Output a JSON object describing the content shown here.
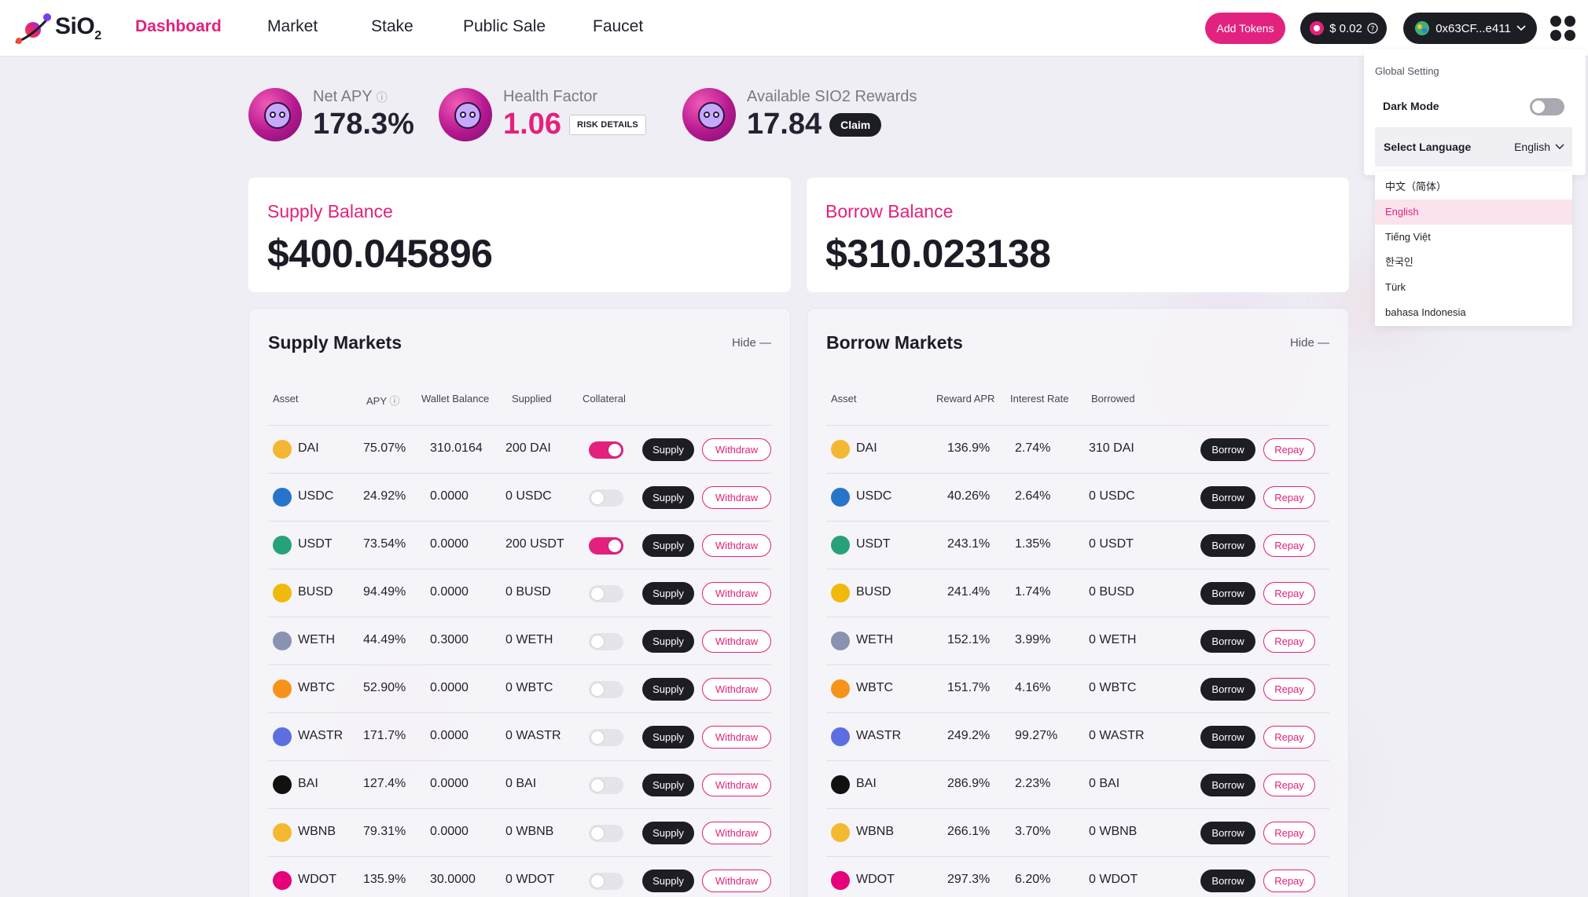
{
  "header": {
    "logo_text": "SiO",
    "logo_sub": "2",
    "nav": [
      {
        "label": "Dashboard",
        "active": true
      },
      {
        "label": "Market",
        "active": false
      },
      {
        "label": "Stake",
        "active": false
      },
      {
        "label": "Public Sale",
        "active": false
      },
      {
        "label": "Faucet",
        "active": false
      }
    ],
    "add_tokens": "Add Tokens",
    "price": "$ 0.02",
    "address": "0x63CF...e411"
  },
  "stats": {
    "net_apy_label": "Net APY",
    "net_apy_value": "178.3%",
    "health_label": "Health Factor",
    "health_value": "1.06",
    "risk_details": "RISK DETAILS",
    "rewards_label": "Available SIO2 Rewards",
    "rewards_value": "17.84",
    "claim": "Claim"
  },
  "supply_balance": {
    "label": "Supply Balance",
    "value": "$400.045896"
  },
  "borrow_balance": {
    "label": "Borrow Balance",
    "value": "$310.023138"
  },
  "supply_markets": {
    "title": "Supply Markets",
    "hide": "Hide",
    "headers": [
      "Asset",
      "APY",
      "Wallet Balance",
      "Supplied",
      "Collateral"
    ],
    "supply_label": "Supply",
    "withdraw_label": "Withdraw",
    "rows": [
      {
        "asset": "DAI",
        "apy": "75.07%",
        "wallet": "310.0164",
        "supplied": "200 DAI",
        "collateral": true
      },
      {
        "asset": "USDC",
        "apy": "24.92%",
        "wallet": "0.0000",
        "supplied": "0 USDC",
        "collateral": false
      },
      {
        "asset": "USDT",
        "apy": "73.54%",
        "wallet": "0.0000",
        "supplied": "200 USDT",
        "collateral": true
      },
      {
        "asset": "BUSD",
        "apy": "94.49%",
        "wallet": "0.0000",
        "supplied": "0 BUSD",
        "collateral": false
      },
      {
        "asset": "WETH",
        "apy": "44.49%",
        "wallet": "0.3000",
        "supplied": "0 WETH",
        "collateral": false
      },
      {
        "asset": "WBTC",
        "apy": "52.90%",
        "wallet": "0.0000",
        "supplied": "0 WBTC",
        "collateral": false
      },
      {
        "asset": "WASTR",
        "apy": "171.7%",
        "wallet": "0.0000",
        "supplied": "0 WASTR",
        "collateral": false
      },
      {
        "asset": "BAI",
        "apy": "127.4%",
        "wallet": "0.0000",
        "supplied": "0 BAI",
        "collateral": false
      },
      {
        "asset": "WBNB",
        "apy": "79.31%",
        "wallet": "0.0000",
        "supplied": "0 WBNB",
        "collateral": false
      },
      {
        "asset": "WDOT",
        "apy": "135.9%",
        "wallet": "30.0000",
        "supplied": "0 WDOT",
        "collateral": false
      }
    ]
  },
  "borrow_markets": {
    "title": "Borrow Markets",
    "hide": "Hide",
    "headers": [
      "Asset",
      "Reward APR",
      "Interest Rate",
      "Borrowed"
    ],
    "borrow_label": "Borrow",
    "repay_label": "Repay",
    "rows": [
      {
        "asset": "DAI",
        "reward": "136.9%",
        "interest": "2.74%",
        "borrowed": "310 DAI"
      },
      {
        "asset": "USDC",
        "reward": "40.26%",
        "interest": "2.64%",
        "borrowed": "0 USDC"
      },
      {
        "asset": "USDT",
        "reward": "243.1%",
        "interest": "1.35%",
        "borrowed": "0 USDT"
      },
      {
        "asset": "BUSD",
        "reward": "241.4%",
        "interest": "1.74%",
        "borrowed": "0 BUSD"
      },
      {
        "asset": "WETH",
        "reward": "152.1%",
        "interest": "3.99%",
        "borrowed": "0 WETH"
      },
      {
        "asset": "WBTC",
        "reward": "151.7%",
        "interest": "4.16%",
        "borrowed": "0 WBTC"
      },
      {
        "asset": "WASTR",
        "reward": "249.2%",
        "interest": "99.27%",
        "borrowed": "0 WASTR"
      },
      {
        "asset": "BAI",
        "reward": "286.9%",
        "interest": "2.23%",
        "borrowed": "0 BAI"
      },
      {
        "asset": "WBNB",
        "reward": "266.1%",
        "interest": "3.70%",
        "borrowed": "0 WBNB"
      },
      {
        "asset": "WDOT",
        "reward": "297.3%",
        "interest": "6.20%",
        "borrowed": "0 WDOT"
      }
    ]
  },
  "coin_colors": {
    "DAI": "#f4b731",
    "USDC": "#2775ca",
    "USDT": "#26a17b",
    "BUSD": "#f0b90b",
    "WETH": "#8a92b2",
    "WBTC": "#f7931a",
    "WASTR": "#5b6fe0",
    "BAI": "#111111",
    "WBNB": "#f3ba2f",
    "WDOT": "#e6007a"
  },
  "settings": {
    "title": "Global Setting",
    "dark_mode": "Dark Mode",
    "dark_mode_on": false,
    "select_language": "Select Language",
    "current_language": "English",
    "languages": [
      "中文（简体）",
      "English",
      "Tiếng Việt",
      "한국인",
      "Türk",
      "bahasa Indonesia"
    ],
    "selected_index": 1
  },
  "colors": {
    "accent": "#e3217c",
    "dark": "#1d1d24"
  }
}
